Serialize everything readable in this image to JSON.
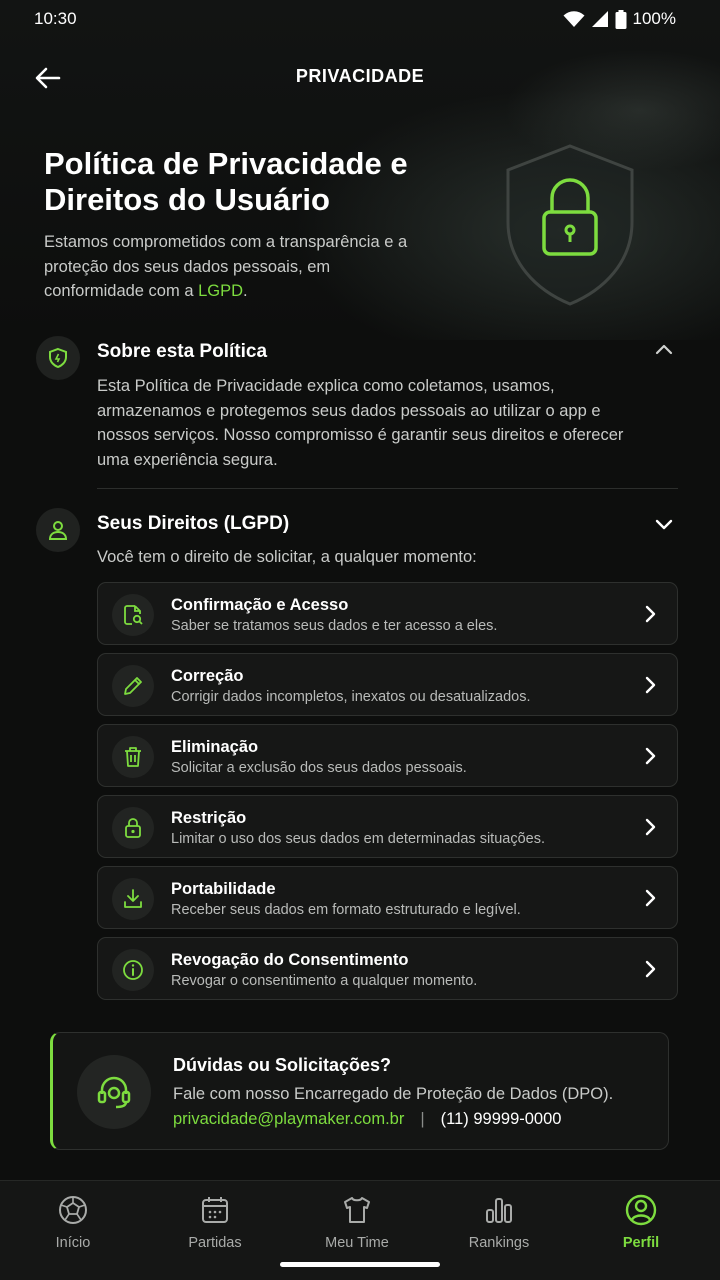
{
  "status_bar": {
    "time": "10:30",
    "battery": "100%"
  },
  "header": {
    "title": "PRIVACIDADE"
  },
  "hero": {
    "title": "Política de Privacidade e Direitos do Usuário",
    "subtitle_before": "Estamos comprometidos com a transparência e a proteção dos seus dados pessoais, em conformidade com a ",
    "subtitle_highlight": "LGPD",
    "subtitle_after": "."
  },
  "about": {
    "title": "Sobre esta Política",
    "text": "Esta Política de Privacidade explica como coletamos, usamos, armazenamos e protegemos seus dados pessoais ao utilizar o app e nossos serviços. Nosso compromisso é garantir seus direitos e oferecer uma experiência segura."
  },
  "rights": {
    "title": "Seus Direitos (LGPD)",
    "intro": "Você tem o direito de solicitar, a qualquer momento:",
    "items": [
      {
        "title": "Confirmação e Acesso",
        "desc": "Saber se tratamos seus dados e ter acesso a eles.",
        "icon": "document-search-icon"
      },
      {
        "title": "Correção",
        "desc": "Corrigir dados incompletos, inexatos ou desatualizados.",
        "icon": "pencil-icon"
      },
      {
        "title": "Eliminação",
        "desc": "Solicitar a exclusão dos seus dados pessoais.",
        "icon": "trash-icon"
      },
      {
        "title": "Restrição",
        "desc": "Limitar o uso dos seus dados em determinadas situações.",
        "icon": "lock-icon"
      },
      {
        "title": "Portabilidade",
        "desc": "Receber seus dados em formato estruturado e legível.",
        "icon": "download-icon"
      },
      {
        "title": "Revogação do Consentimento",
        "desc": "Revogar o consentimento a qualquer momento.",
        "icon": "info-icon"
      }
    ]
  },
  "contact": {
    "title": "Dúvidas ou Solicitações?",
    "subtitle": "Fale com nosso Encarregado de Proteção de Dados (DPO).",
    "email": "privacidade@playmaker.com.br",
    "separator": "|",
    "phone": "(11) 99999-0000"
  },
  "bottom_nav": [
    {
      "label": "Início",
      "icon": "soccer-ball-icon",
      "active": false
    },
    {
      "label": "Partidas",
      "icon": "calendar-icon",
      "active": false
    },
    {
      "label": "Meu Time",
      "icon": "jersey-icon",
      "active": false
    },
    {
      "label": "Rankings",
      "icon": "bar-chart-icon",
      "active": false
    },
    {
      "label": "Perfil",
      "icon": "profile-icon",
      "active": true
    }
  ],
  "colors": {
    "accent": "#7ddc3f",
    "background": "#0d0e0d"
  }
}
